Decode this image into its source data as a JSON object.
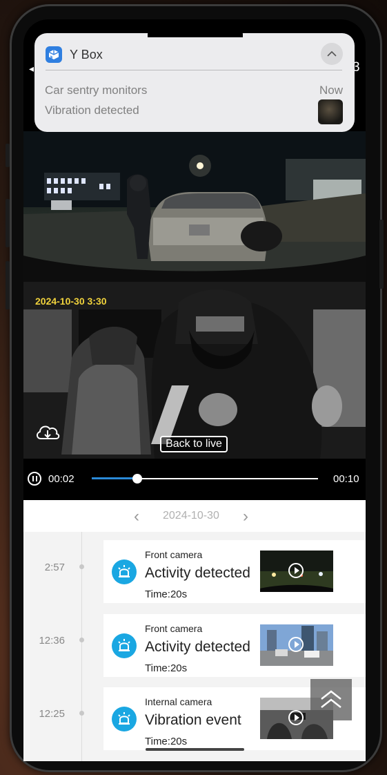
{
  "notification": {
    "app_name": "Y Box",
    "app_icon": "cube-icon",
    "title": "Car sentry monitors",
    "body": "Vibration detected",
    "time": "Now"
  },
  "status_bar": {
    "left_glyph": "◂",
    "right_glyph": "3"
  },
  "video": {
    "timestamp": "2024-10-30 3:30",
    "back_to_live_label": "Back to live",
    "download_icon": "cloud-download-icon"
  },
  "player": {
    "current_time": "00:02",
    "total_time": "00:10",
    "progress": 0.2
  },
  "date_nav": {
    "prev_glyph": "‹",
    "date": "2024-10-30",
    "next_glyph": "›"
  },
  "events": [
    {
      "time_label": "2:57",
      "camera": "Front camera",
      "event": "Activity detected",
      "duration": "Time:20s"
    },
    {
      "time_label": "12:36",
      "camera": "Front camera",
      "event": "Activity detected",
      "duration": "Time:20s"
    },
    {
      "time_label": "12:25",
      "camera": "Internal camera",
      "event": "Vibration event",
      "duration": "Time:20s"
    }
  ],
  "colors": {
    "accent": "#1aa7e2",
    "progress": "#2a8ad8",
    "timestamp": "#f0d23c"
  }
}
